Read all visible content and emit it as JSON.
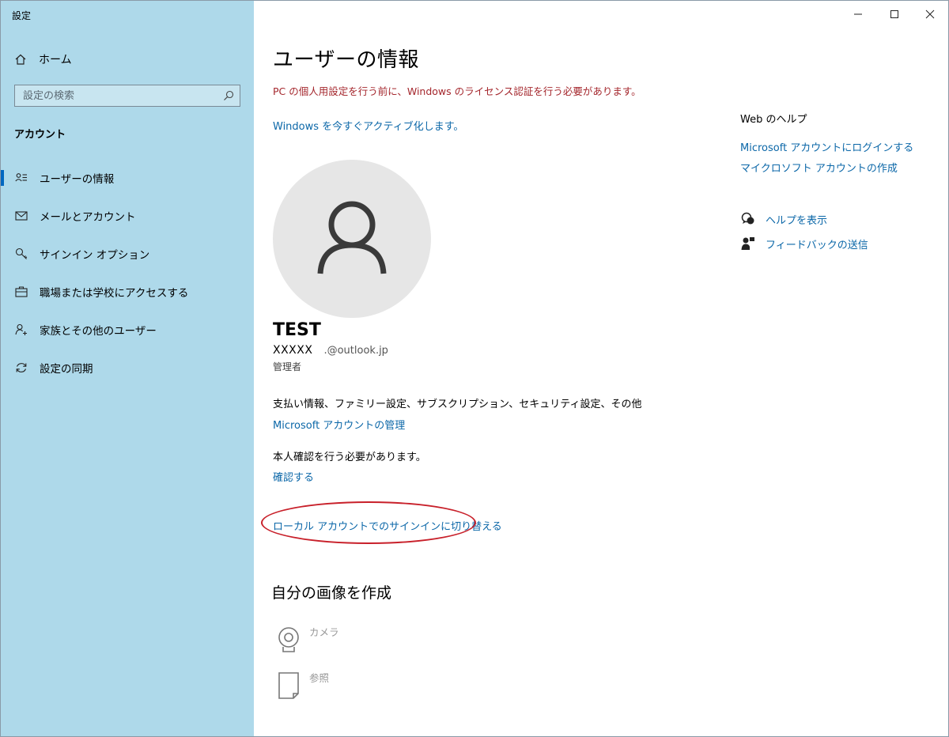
{
  "window": {
    "title": "設定",
    "controls": {
      "minimize": "minimize-icon",
      "maximize": "maximize-icon",
      "close": "close-icon"
    }
  },
  "sidebar": {
    "home_label": "ホーム",
    "search_placeholder": "設定の検索",
    "section_title": "アカウント",
    "items": [
      {
        "label": "ユーザーの情報",
        "icon": "user-info-icon",
        "active": true
      },
      {
        "label": "メールとアカウント",
        "icon": "mail-icon",
        "active": false
      },
      {
        "label": "サインイン オプション",
        "icon": "key-icon",
        "active": false
      },
      {
        "label": "職場または学校にアクセスする",
        "icon": "briefcase-icon",
        "active": false
      },
      {
        "label": "家族とその他のユーザー",
        "icon": "person-add-icon",
        "active": false
      },
      {
        "label": "設定の同期",
        "icon": "sync-icon",
        "active": false
      }
    ]
  },
  "main": {
    "title": "ユーザーの情報",
    "warning": "PC の個人用設定を行う前に、Windows のライセンス認証を行う必要があります。",
    "activate_link": "Windows を今すぐアクティブ化します。",
    "user": {
      "name": "TEST",
      "email_local": "XXXXX",
      "email_domain": ".@outlook.jp",
      "role": "管理者"
    },
    "billing_text": "支払い情報、ファミリー設定、サブスクリプション、セキュリティ設定、その他",
    "manage_link": "Microsoft アカウントの管理",
    "verify_text": "本人確認を行う必要があります。",
    "verify_link": "確認する",
    "local_account_link": "ローカル アカウントでのサインインに切り替える",
    "create_picture": {
      "title": "自分の画像を作成",
      "camera_label": "カメラ",
      "browse_label": "参照"
    }
  },
  "help": {
    "heading": "Web のヘルプ",
    "links": [
      "Microsoft アカウントにログインする",
      "マイクロソフト アカウントの作成"
    ],
    "get_help": "ヘルプを表示",
    "feedback": "フィードバックの送信"
  },
  "colors": {
    "sidebar_bg": "#aed9ea",
    "link": "#0b67a8",
    "warning": "#a4262c",
    "active_indicator": "#0067c0",
    "highlight_ellipse": "#c8202a"
  }
}
